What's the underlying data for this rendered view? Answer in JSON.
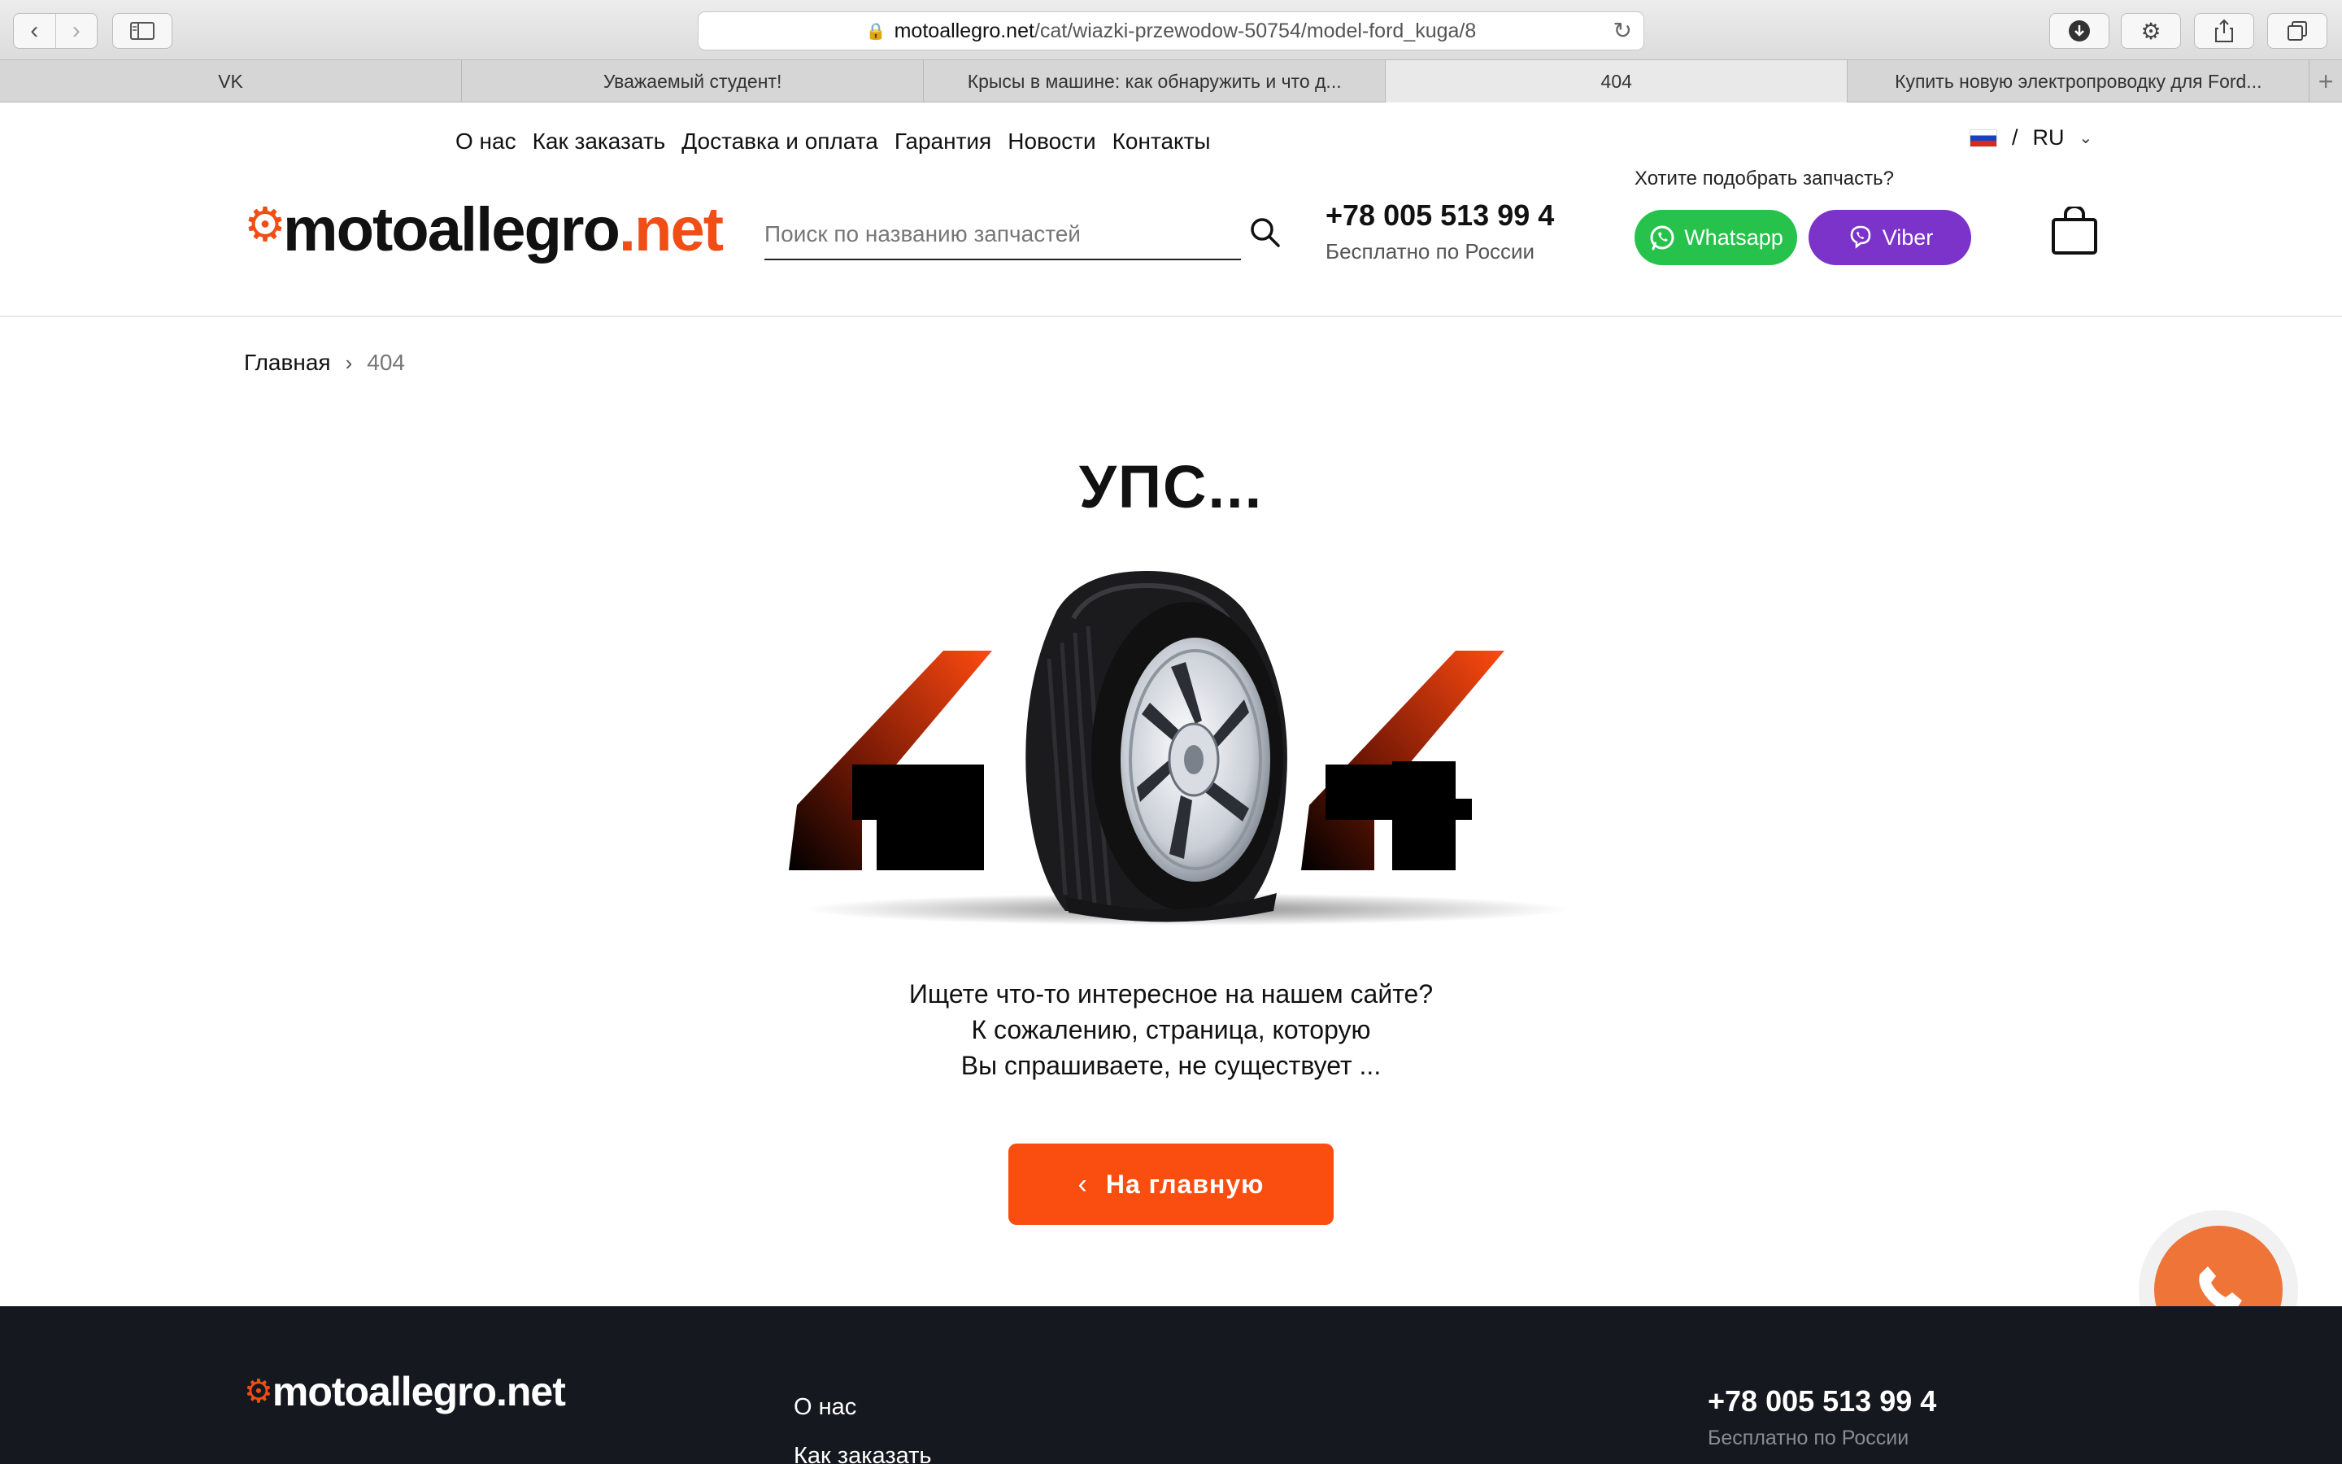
{
  "browser": {
    "url_domain": "motoallegro.net",
    "url_path": "/cat/wiazki-przewodow-50754/model-ford_kuga/8",
    "tabs": [
      {
        "label": "VK",
        "active": false
      },
      {
        "label": "Уважаемый студент!",
        "active": false
      },
      {
        "label": "Крысы в машине: как обнаружить и что д...",
        "active": false
      },
      {
        "label": "404",
        "active": true
      },
      {
        "label": "Купить новую электропроводку для Ford...",
        "active": false
      }
    ]
  },
  "header": {
    "menu": [
      "О нас",
      "Как заказать",
      "Доставка и оплата",
      "Гарантия",
      "Новости",
      "Контакты"
    ],
    "lang": {
      "separator": "/",
      "code": "RU"
    },
    "logo": {
      "dark": "motoallegro",
      "orange": ".net"
    },
    "search": {
      "placeholder": "Поиск по названию запчастей",
      "value": ""
    },
    "phone": {
      "number": "+78 005 513 99 4",
      "note": "Бесплатно по России"
    },
    "pick_label": "Хотите подобрать запчасть?",
    "whatsapp_label": "Whatsapp",
    "viber_label": "Viber"
  },
  "breadcrumb": {
    "home": "Главная",
    "current": "404"
  },
  "main": {
    "title": "УПС...",
    "message_lines": [
      "Ищете что-то интересное на нашем сайте?",
      "К сожалению, страница, которую",
      "Вы спрашиваете, не существует ..."
    ],
    "home_button": "На главную"
  },
  "footer": {
    "logo": "motoallegro.net",
    "menu": [
      "О нас",
      "Как заказать"
    ],
    "phone": {
      "number": "+78 005 513 99 4",
      "note": "Бесплатно по России"
    }
  },
  "colors": {
    "accent": "#f94e0f",
    "whatsapp": "#27c24c",
    "viber": "#7b33c9",
    "footer_bg": "#161820",
    "call": "#ee7437"
  }
}
